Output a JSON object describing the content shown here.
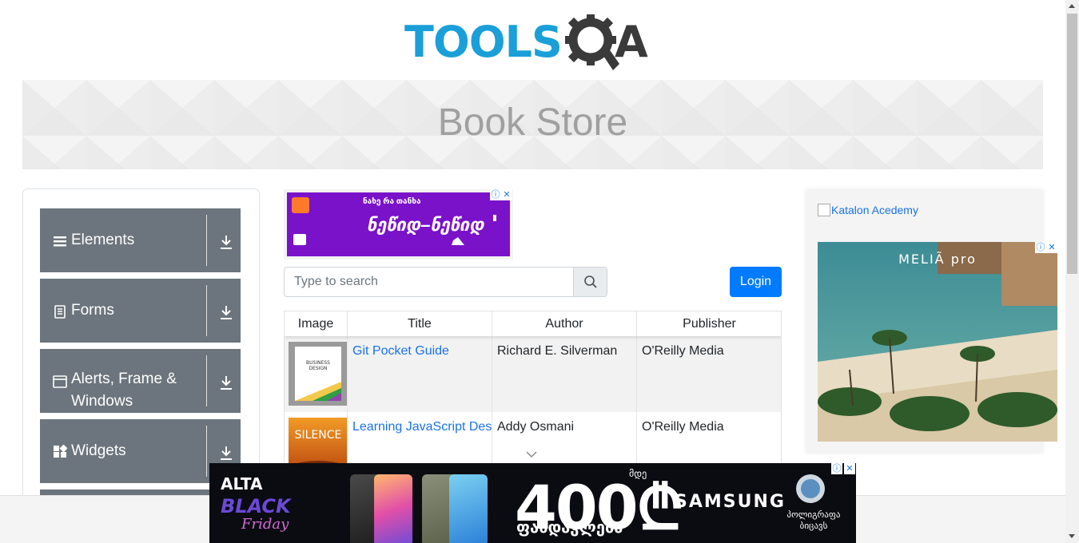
{
  "logo": {
    "brand_part1": "TOOLS",
    "brand_part2": "A"
  },
  "banner": {
    "title": "Book Store"
  },
  "sidebar": {
    "groups": [
      {
        "label": "Elements",
        "icon": "hamburger-icon"
      },
      {
        "label": "Forms",
        "icon": "document-icon"
      },
      {
        "label": "Alerts, Frame & Windows",
        "icon": "window-icon"
      },
      {
        "label": "Widgets",
        "icon": "widgets-icon"
      }
    ]
  },
  "ad_top": {
    "line1": "ნახე რა თანხა",
    "line2": "ნეწიდ–ნეწიდ"
  },
  "search": {
    "placeholder": "Type to search"
  },
  "login": {
    "label": "Login"
  },
  "table": {
    "headers": [
      "Image",
      "Title",
      "Author",
      "Publisher"
    ],
    "rows": [
      {
        "title": "Git Pocket Guide",
        "author": "Richard E. Silverman",
        "publisher": "O'Reilly Media",
        "cover_text": "BUSINESS DESIGN"
      },
      {
        "title": "Learning JavaScript Design Patterns",
        "author": "Addy Osmani",
        "publisher": "O'Reilly Media",
        "cover_text": "SILENCE"
      }
    ]
  },
  "right_ad": {
    "alt_text": "Katalon Acedemy",
    "brand": "MELIÃ pro"
  },
  "bottom_ad": {
    "brand": "ALTA",
    "promo1": "BLACK",
    "promo2": "Friday",
    "amount": "400₾",
    "amount_prefix": "მდე",
    "discount": "ფასდაკლება",
    "partner": "SAMSUNG",
    "extra": "პოლიგრაფა ბიცავს"
  },
  "colors": {
    "accent": "#007bff",
    "sidebar_bg": "#6c757d",
    "logo_blue": "#1a9fd8",
    "link": "#1a73e8"
  }
}
